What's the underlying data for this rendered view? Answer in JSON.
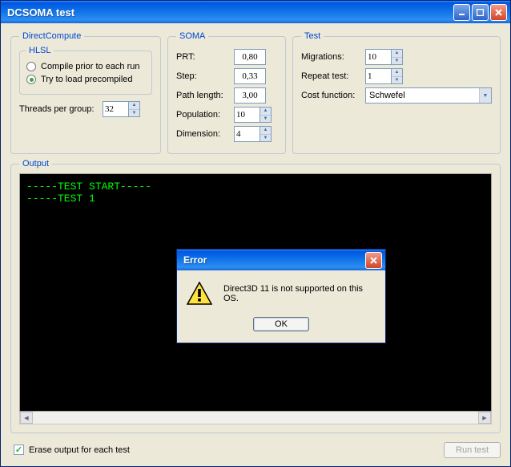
{
  "window": {
    "title": "DCSOMA test"
  },
  "groups": {
    "directCompute": {
      "legend": "DirectCompute",
      "hlsl": {
        "legend": "HLSL",
        "optCompile": "Compile prior to each run",
        "optLoad": "Try to load precompiled",
        "selected": "load"
      },
      "threadsLabel": "Threads per group:",
      "threadsValue": "32"
    },
    "soma": {
      "legend": "SOMA",
      "prtLabel": "PRT:",
      "prtValue": "0,80",
      "stepLabel": "Step:",
      "stepValue": "0,33",
      "pathLabel": "Path length:",
      "pathValue": "3,00",
      "popLabel": "Population:",
      "popValue": "10",
      "dimLabel": "Dimension:",
      "dimValue": "4"
    },
    "test": {
      "legend": "Test",
      "migrationsLabel": "Migrations:",
      "migrationsValue": "10",
      "repeatLabel": "Repeat test:",
      "repeatValue": "1",
      "costLabel": "Cost function:",
      "costValue": "Schwefel"
    },
    "output": {
      "legend": "Output",
      "consoleText": "-----TEST START-----\n-----TEST 1"
    }
  },
  "footer": {
    "eraseLabel": "Erase output for each test",
    "eraseChecked": true,
    "runLabel": "Run test"
  },
  "errorDialog": {
    "title": "Error",
    "message": "Direct3D 11 is not supported on this OS.",
    "okLabel": "OK"
  }
}
